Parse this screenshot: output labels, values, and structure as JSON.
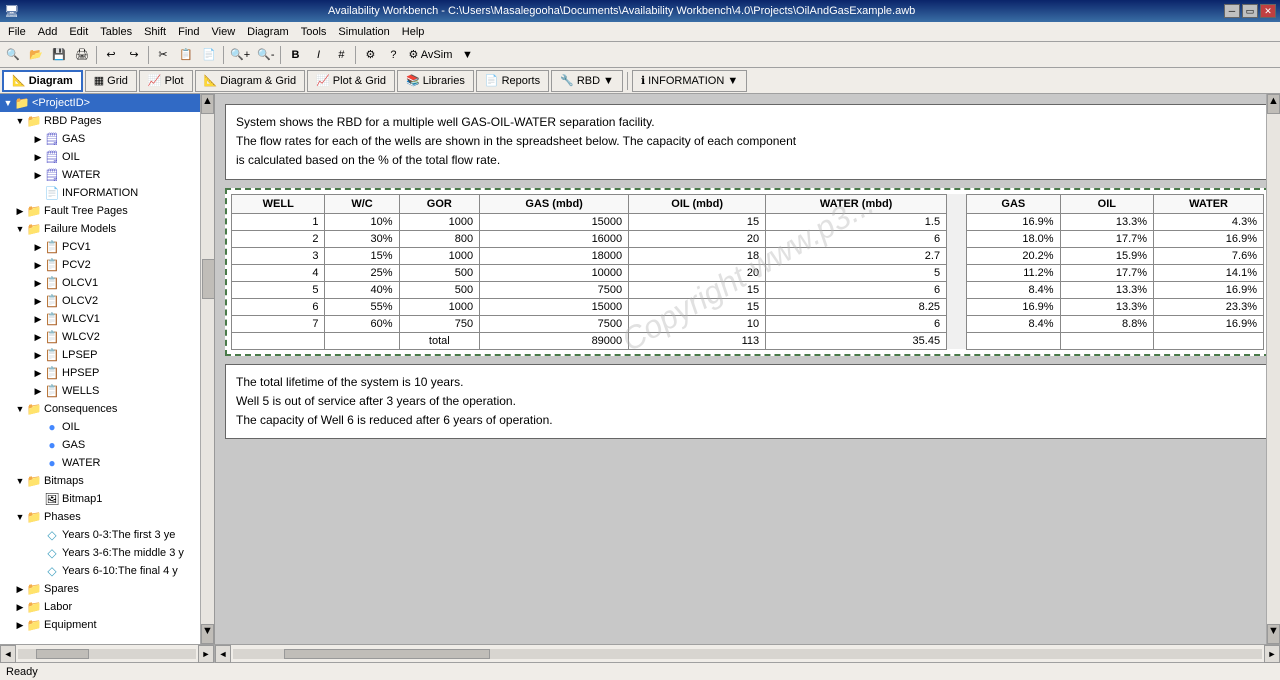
{
  "titlebar": {
    "title": "Availability Workbench - C:\\Users\\Masalegooha\\Documents\\Availability Workbench\\4.0\\Projects\\OilAndGasExample.awb"
  },
  "menubar": {
    "items": [
      "File",
      "Edit",
      "Tables",
      "Shift",
      "Find",
      "View",
      "Diagram",
      "Tools",
      "Simulation",
      "Help"
    ]
  },
  "toolbar2": {
    "buttons": [
      {
        "label": "Diagram",
        "icon": "📐",
        "active": true
      },
      {
        "label": "Grid",
        "icon": "▦",
        "active": false
      },
      {
        "label": "Plot",
        "icon": "📈",
        "active": false
      },
      {
        "label": "Diagram & Grid",
        "icon": "📐▦",
        "active": false
      },
      {
        "label": "Plot & Grid",
        "icon": "📈▦",
        "active": false
      },
      {
        "label": "Libraries",
        "icon": "📚",
        "active": false
      },
      {
        "label": "Reports",
        "icon": "📄",
        "active": false
      },
      {
        "label": "RBD",
        "icon": "🔧",
        "active": false
      },
      {
        "label": "INFORMATION",
        "icon": "ℹ",
        "active": false
      }
    ]
  },
  "sidebar": {
    "selected": "ProjectID",
    "tree": [
      {
        "id": "project",
        "label": "<ProjectID>",
        "level": 0,
        "expanded": true,
        "type": "folder"
      },
      {
        "id": "rbd-pages",
        "label": "RBD Pages",
        "level": 1,
        "expanded": true,
        "type": "folder"
      },
      {
        "id": "gas",
        "label": "GAS",
        "level": 2,
        "expanded": false,
        "type": "page"
      },
      {
        "id": "oil",
        "label": "OIL",
        "level": 2,
        "expanded": false,
        "type": "page"
      },
      {
        "id": "water",
        "label": "WATER",
        "level": 2,
        "expanded": false,
        "type": "page"
      },
      {
        "id": "information",
        "label": "INFORMATION",
        "level": 2,
        "expanded": false,
        "type": "doc"
      },
      {
        "id": "fault-tree",
        "label": "Fault Tree Pages",
        "level": 1,
        "expanded": false,
        "type": "folder"
      },
      {
        "id": "failure-models",
        "label": "Failure Models",
        "level": 1,
        "expanded": true,
        "type": "folder"
      },
      {
        "id": "pcv1",
        "label": "PCV1",
        "level": 2,
        "expanded": false,
        "type": "model"
      },
      {
        "id": "pcv2",
        "label": "PCV2",
        "level": 2,
        "expanded": false,
        "type": "model"
      },
      {
        "id": "olcv1",
        "label": "OLCV1",
        "level": 2,
        "expanded": false,
        "type": "model"
      },
      {
        "id": "olcv2",
        "label": "OLCV2",
        "level": 2,
        "expanded": false,
        "type": "model"
      },
      {
        "id": "wlcv1",
        "label": "WLCV1",
        "level": 2,
        "expanded": false,
        "type": "model"
      },
      {
        "id": "wlcv2",
        "label": "WLCV2",
        "level": 2,
        "expanded": false,
        "type": "model"
      },
      {
        "id": "lpsep",
        "label": "LPSEP",
        "level": 2,
        "expanded": false,
        "type": "model"
      },
      {
        "id": "hpsep",
        "label": "HPSEP",
        "level": 2,
        "expanded": false,
        "type": "model"
      },
      {
        "id": "wells",
        "label": "WELLS",
        "level": 2,
        "expanded": false,
        "type": "model"
      },
      {
        "id": "consequences",
        "label": "Consequences",
        "level": 1,
        "expanded": true,
        "type": "folder"
      },
      {
        "id": "oil-con",
        "label": "OIL",
        "level": 2,
        "expanded": false,
        "type": "blue-circle"
      },
      {
        "id": "gas-con",
        "label": "GAS",
        "level": 2,
        "expanded": false,
        "type": "blue-circle"
      },
      {
        "id": "water-con",
        "label": "WATER",
        "level": 2,
        "expanded": false,
        "type": "blue-circle"
      },
      {
        "id": "bitmaps",
        "label": "Bitmaps",
        "level": 1,
        "expanded": true,
        "type": "folder"
      },
      {
        "id": "bitmap1",
        "label": "Bitmap1",
        "level": 2,
        "expanded": false,
        "type": "bitmap"
      },
      {
        "id": "phases",
        "label": "Phases",
        "level": 1,
        "expanded": true,
        "type": "folder"
      },
      {
        "id": "years0-3",
        "label": "Years 0-3:The first 3 ye",
        "level": 2,
        "expanded": false,
        "type": "phase"
      },
      {
        "id": "years3-6",
        "label": "Years 3-6:The middle 3 y",
        "level": 2,
        "expanded": false,
        "type": "phase"
      },
      {
        "id": "years6-10",
        "label": "Years 6-10:The final 4 y",
        "level": 2,
        "expanded": false,
        "type": "phase"
      },
      {
        "id": "spares",
        "label": "Spares",
        "level": 1,
        "expanded": false,
        "type": "folder"
      },
      {
        "id": "labor",
        "label": "Labor",
        "level": 1,
        "expanded": false,
        "type": "folder"
      },
      {
        "id": "equipment",
        "label": "Equipment",
        "level": 1,
        "expanded": false,
        "type": "folder"
      }
    ]
  },
  "description1": {
    "lines": [
      "System shows the RBD for a multiple well GAS-OIL-WATER  separation facility.",
      "The flow rates for each of the wells are shown in the spreadsheet below. The capacity of each component",
      "is calculated based on the % of the total flow rate."
    ]
  },
  "table": {
    "headers": [
      "WELL",
      "W/C",
      "GOR",
      "GAS (mbd)",
      "OIL (mbd)",
      "WATER (mbd)",
      "",
      "GAS",
      "OIL",
      "WATER"
    ],
    "rows": [
      [
        "1",
        "10%",
        "1000",
        "15000",
        "15",
        "1.5",
        "",
        "16.9%",
        "13.3%",
        "4.3%"
      ],
      [
        "2",
        "30%",
        "800",
        "16000",
        "20",
        "6",
        "",
        "18.0%",
        "17.7%",
        "16.9%"
      ],
      [
        "3",
        "15%",
        "1000",
        "18000",
        "18",
        "2.7",
        "",
        "20.2%",
        "15.9%",
        "7.6%"
      ],
      [
        "4",
        "25%",
        "500",
        "10000",
        "20",
        "5",
        "",
        "11.2%",
        "17.7%",
        "14.1%"
      ],
      [
        "5",
        "40%",
        "500",
        "7500",
        "15",
        "6",
        "",
        "8.4%",
        "13.3%",
        "16.9%"
      ],
      [
        "6",
        "55%",
        "1000",
        "15000",
        "15",
        "8.25",
        "",
        "16.9%",
        "13.3%",
        "23.3%"
      ],
      [
        "7",
        "60%",
        "750",
        "7500",
        "10",
        "6",
        "",
        "8.4%",
        "8.8%",
        "16.9%"
      ]
    ],
    "total_row": [
      "",
      "",
      "total",
      "89000",
      "113",
      "35.45",
      "",
      "",
      "",
      ""
    ]
  },
  "description2": {
    "lines": [
      "The total lifetime of the system is 10 years.",
      "Well 5 is out of service after 3 years of the operation.",
      "The capacity of Well 6 is reduced after 6 years of operation."
    ]
  },
  "statusbar": {
    "text": "Ready"
  }
}
